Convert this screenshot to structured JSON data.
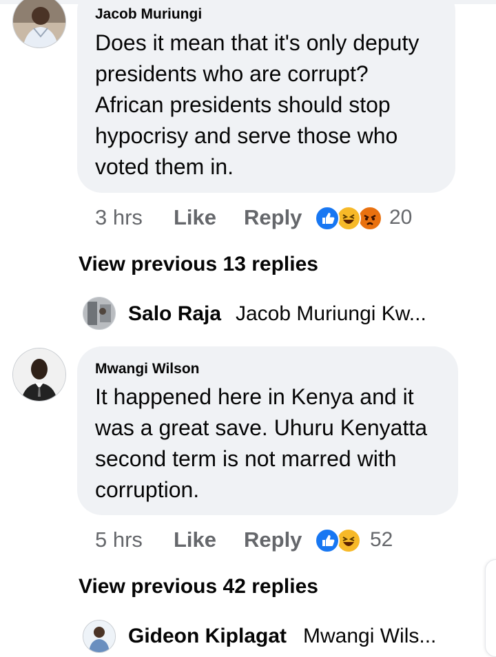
{
  "comments": [
    {
      "author": "Jacob Muriungi",
      "text": "Does it mean that it's only deputy\npresidents who are corrupt?\nAfrican presidents should stop\nhypocrisy and serve those who\nvoted them in.",
      "time": "3 hrs",
      "like_label": "Like",
      "reply_label": "Reply",
      "reactions": [
        "like-icon",
        "haha-icon",
        "angry-icon"
      ],
      "reaction_count": "20",
      "view_previous": "View previous 13 replies",
      "latest_reply": {
        "author": "Salo Raja",
        "text": "Jacob Muriungi Kw..."
      }
    },
    {
      "author": "Mwangi Wilson",
      "text": "It happened here in Kenya and it\nwas a great save. Uhuru Kenyatta\nsecond term is not marred with\ncorruption.",
      "time": "5 hrs",
      "like_label": "Like",
      "reply_label": "Reply",
      "reactions": [
        "like-icon",
        "haha-icon"
      ],
      "reaction_count": "52",
      "view_previous": "View previous 42 replies",
      "latest_reply": {
        "author": "Gideon Kiplagat",
        "text": "Mwangi Wils..."
      }
    }
  ],
  "colors": {
    "bubble": "#f0f2f5",
    "meta_text": "#65676b",
    "like_blue": "#1877f2",
    "haha_yellow": "#f7b928",
    "angry_orange": "#e9710f"
  }
}
